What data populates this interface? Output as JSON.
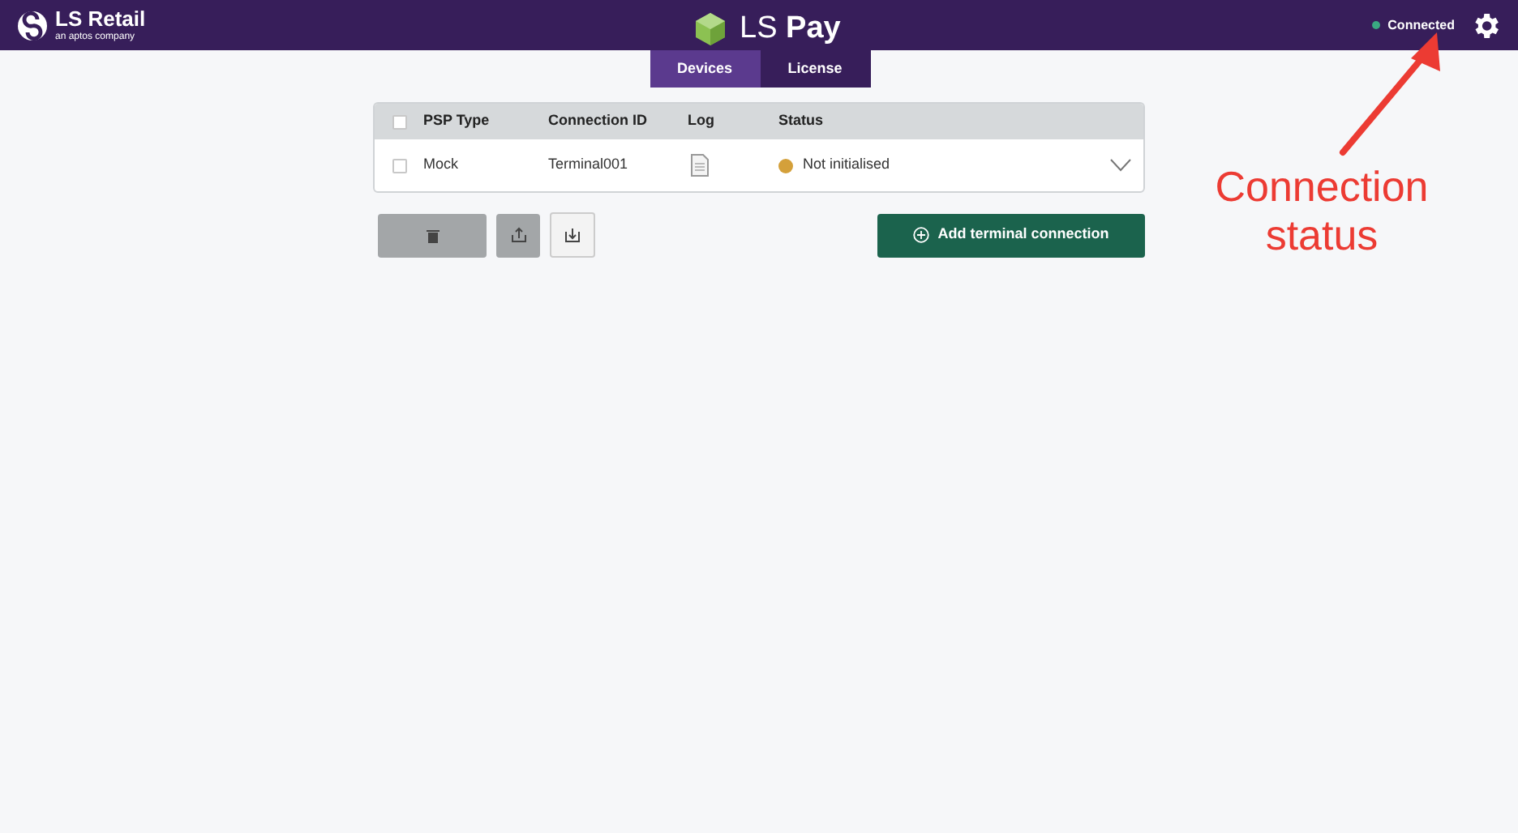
{
  "header": {
    "brand": "LS Retail",
    "brand_subtitle": "an aptos company",
    "app_title_light": "LS",
    "app_title_bold": "Pay",
    "connection": {
      "label": "Connected",
      "color": "#3aa882"
    }
  },
  "tabs": [
    {
      "label": "Devices",
      "selected": true
    },
    {
      "label": "License",
      "selected": false
    }
  ],
  "table": {
    "select_all_checked": false,
    "columns": [
      "PSP Type",
      "Connection ID",
      "Log",
      "Status"
    ],
    "rows": [
      {
        "checked": false,
        "psp_type": "Mock",
        "connection_id": "Terminal001",
        "status": "Not initialised",
        "color": "#d4a03a",
        "expanded": false
      }
    ]
  },
  "actions": {
    "add_button": "Add terminal connection"
  },
  "annotation": {
    "text": "Connection status"
  }
}
